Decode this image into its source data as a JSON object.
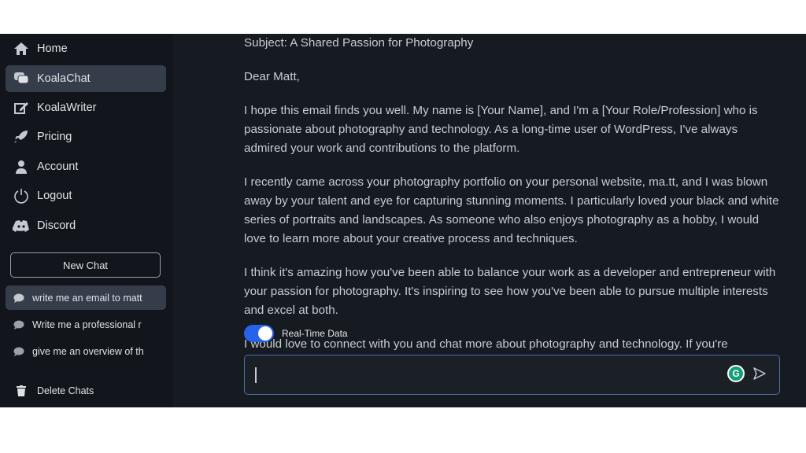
{
  "sidebar": {
    "nav": [
      {
        "label": "Home",
        "icon": "home-icon"
      },
      {
        "label": "KoalaChat",
        "icon": "chat-bubbles-icon",
        "active": true
      },
      {
        "label": "KoalaWriter",
        "icon": "edit-icon"
      },
      {
        "label": "Pricing",
        "icon": "rocket-icon"
      },
      {
        "label": "Account",
        "icon": "user-icon"
      },
      {
        "label": "Logout",
        "icon": "power-icon"
      },
      {
        "label": "Discord",
        "icon": "discord-icon"
      }
    ],
    "new_chat": "New Chat",
    "chats": [
      "write me an email to matt",
      "Write me a professional r",
      "give me an overview of th"
    ],
    "delete_chats": "Delete Chats"
  },
  "message": {
    "paragraphs": [
      "Subject: A Shared Passion for Photography",
      "Dear Matt,",
      "I hope this email finds you well. My name is [Your Name], and I'm a [Your Role/Profession] who is passionate about photography and technology. As a long-time user of WordPress, I've always admired your work and contributions to the platform.",
      "I recently came across your photography portfolio on your personal website, ma.tt, and I was blown away by your talent and eye for capturing stunning moments. I particularly loved your black and white series of portraits and landscapes. As someone who also enjoys photography as a hobby, I would love to learn more about your creative process and techniques.",
      "I think it's amazing how you've been able to balance your work as a developer and entrepreneur with your passion for photography. It's inspiring to see how you've been able to pursue multiple interests and excel at both.",
      "I would love to connect with you and chat more about photography and technology. If you're"
    ]
  },
  "realtime": {
    "label": "Real-Time Data",
    "on": true
  },
  "input": {
    "value": "",
    "grammarly": "G"
  },
  "colors": {
    "accent": "#2563eb",
    "active_item": "#363d4a",
    "input_border": "#4d6fa8"
  }
}
